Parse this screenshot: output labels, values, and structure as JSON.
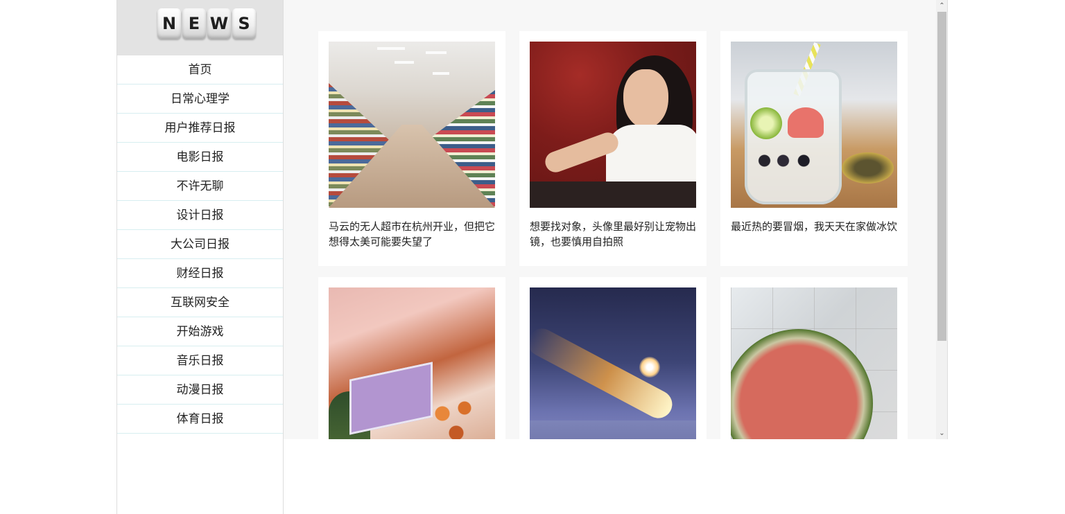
{
  "logo": {
    "letters": [
      "N",
      "E",
      "W",
      "S"
    ]
  },
  "nav": {
    "items": [
      {
        "label": "首页"
      },
      {
        "label": "日常心理学"
      },
      {
        "label": "用户推荐日报"
      },
      {
        "label": "电影日报"
      },
      {
        "label": "不许无聊"
      },
      {
        "label": "设计日报"
      },
      {
        "label": "大公司日报"
      },
      {
        "label": "财经日报"
      },
      {
        "label": "互联网安全"
      },
      {
        "label": "开始游戏"
      },
      {
        "label": "音乐日报"
      },
      {
        "label": "动漫日报"
      },
      {
        "label": "体育日报"
      }
    ]
  },
  "cards": [
    {
      "title": "马云的无人超市在杭州开业，但把它想得太美可能要失望了",
      "image": "supermarket-image"
    },
    {
      "title": "想要找对象，头像里最好别让宠物出镜，也要慎用自拍照",
      "image": "woman-portrait-image"
    },
    {
      "title": "最近热的要冒烟，我天天在家做冰饮",
      "image": "iced-drink-jar-image"
    },
    {
      "title": "",
      "image": "fantasy-island-image"
    },
    {
      "title": "",
      "image": "meteor-image"
    },
    {
      "title": "",
      "image": "watermelon-image"
    }
  ],
  "scrollbar": {
    "up_icon": "chevron-up-icon",
    "down_icon": "chevron-down-icon",
    "up_glyph": "⌃",
    "down_glyph": "⌄"
  }
}
